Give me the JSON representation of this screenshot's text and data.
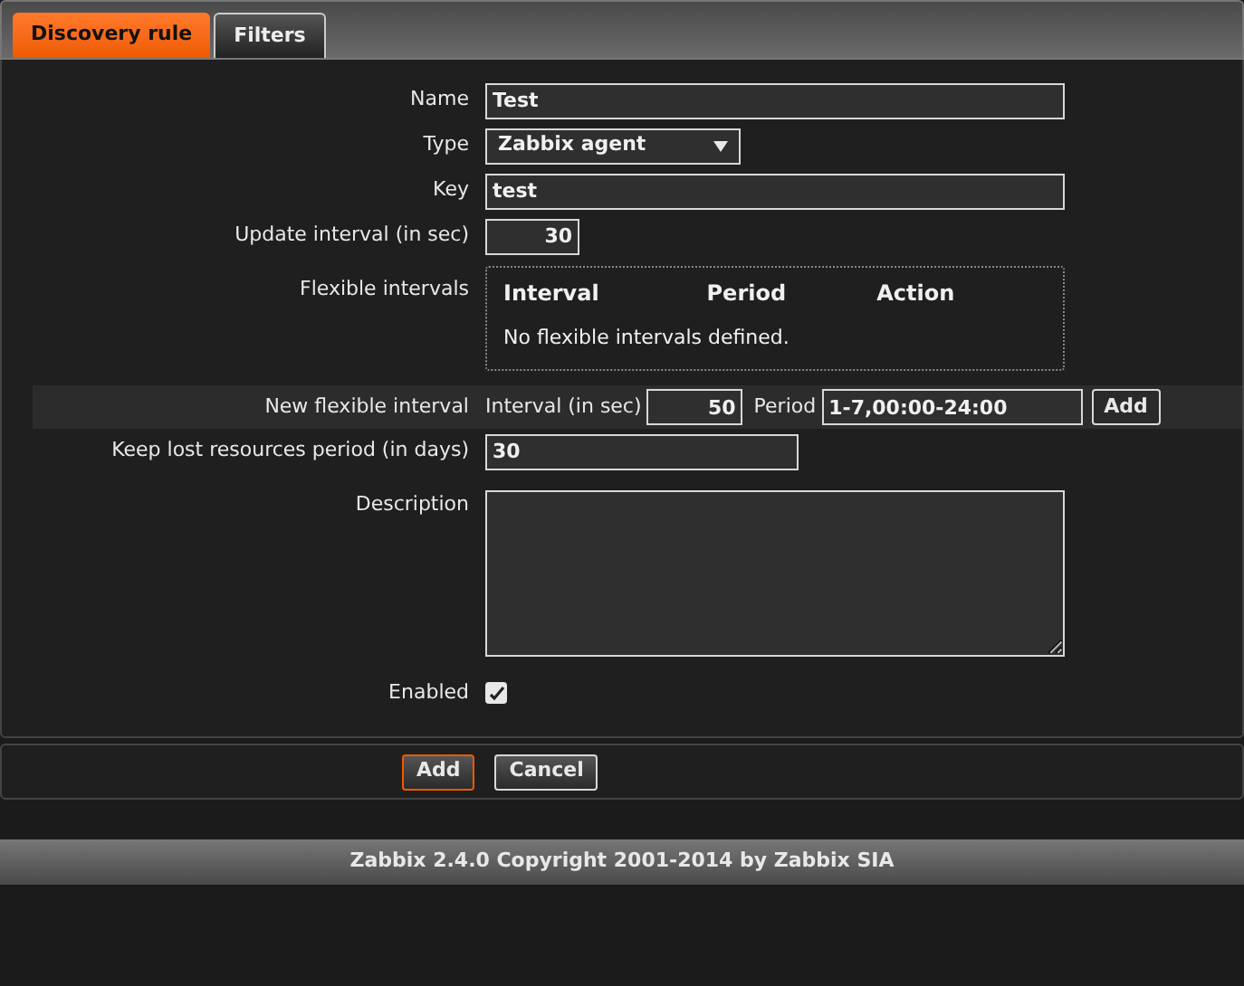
{
  "tabs": [
    {
      "label": "Discovery rule",
      "selected": true
    },
    {
      "label": "Filters",
      "selected": false
    }
  ],
  "rows": [
    {
      "kind": "text",
      "label": "Name",
      "value": "Test"
    },
    {
      "kind": "select",
      "label": "Type",
      "value": "Zabbix agent"
    },
    {
      "kind": "text",
      "label": "Key",
      "value": "test"
    },
    {
      "kind": "number",
      "label": "Update interval (in sec)",
      "value": "30"
    },
    {
      "kind": "intervals",
      "label": "Flexible intervals",
      "columns": [
        "Interval",
        "Period",
        "Action"
      ],
      "empty": "No flexible intervals defined."
    },
    {
      "kind": "newinterval",
      "label": "New flexible interval",
      "interval_label": "Interval (in sec)",
      "interval": "50",
      "period_label": "Period",
      "period": "1-7,00:00-24:00",
      "button": "Add"
    },
    {
      "kind": "shorttext",
      "label": "Keep lost resources period (in days)",
      "value": "30"
    },
    {
      "kind": "textarea",
      "label": "Description",
      "value": ""
    },
    {
      "kind": "checkbox",
      "label": "Enabled",
      "checked": true
    }
  ],
  "buttons": [
    {
      "label": "Add",
      "primary": true
    },
    {
      "label": "Cancel",
      "primary": false
    }
  ],
  "footer": "Zabbix 2.4.0 Copyright 2001-2014 by Zabbix SIA"
}
